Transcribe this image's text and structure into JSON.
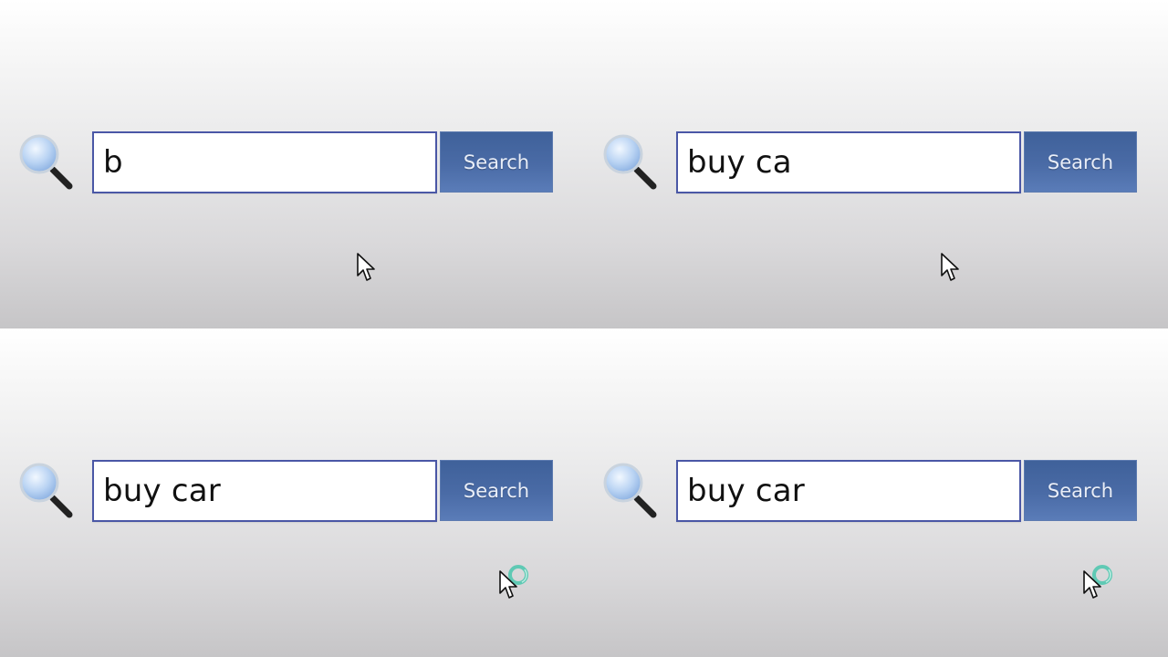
{
  "frames": [
    {
      "query": "b",
      "button_label": "Search",
      "cursor_state": "arrow"
    },
    {
      "query": "buy ca",
      "button_label": "Search",
      "cursor_state": "arrow"
    },
    {
      "query": "buy car",
      "button_label": "Search",
      "cursor_state": "busy"
    },
    {
      "query": "buy car",
      "button_label": "Search",
      "cursor_state": "busy"
    }
  ],
  "icons": {
    "magnifier": "magnifying-glass-icon",
    "cursor": "mouse-pointer-icon",
    "busy": "loading-ring-icon"
  },
  "colors": {
    "field_border": "#4a57a6",
    "button_bg": "#4a6ba6",
    "button_text": "#e9eef8",
    "busy_ring": "#5fc9b4"
  }
}
